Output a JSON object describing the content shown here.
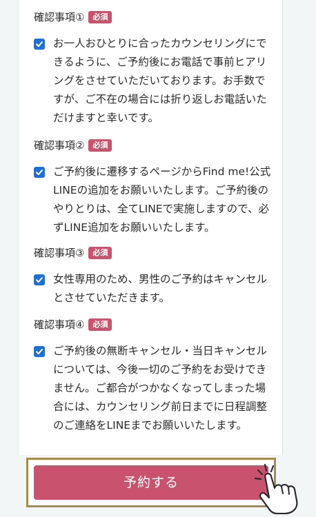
{
  "sections": [
    {
      "title": "確認事項①",
      "badge": "必須",
      "text": "お一人おひとりに合ったカウンセリングにできるように、ご予約後にお電話で事前ヒアリングをさせていただいております。お手数ですが、ご不在の場合には折り返しお電話いただけますと幸いです。",
      "checked": true
    },
    {
      "title": "確認事項②",
      "badge": "必須",
      "text": "ご予約後に遷移するページからFind me!公式LINEの追加をお願いいたします。ご予約後のやりとりは、全てLINEで実施しますので、必ずLINE追加をお願いいたします。",
      "checked": true
    },
    {
      "title": "確認事項③",
      "badge": "必須",
      "text": "女性専用のため、男性のご予約はキャンセルとさせていただきます。",
      "checked": true
    },
    {
      "title": "確認事項④",
      "badge": "必須",
      "text": "ご予約後の無断キャンセル・当日キャンセルについては、今後一切のご予約をお受けできません。ご都合がつかなくなってしまった場合には、カウンセリング前日までに日程調整のご連絡をLINEまでお願いいたします。",
      "checked": true
    }
  ],
  "submit": {
    "label": "予約する"
  },
  "colors": {
    "accent": "#c9536e",
    "checkbox": "#1e6fd9",
    "frame": "#a88a4e"
  },
  "icons": {
    "checkbox": "checkmark-icon",
    "pointer": "hand-pointer-icon"
  }
}
